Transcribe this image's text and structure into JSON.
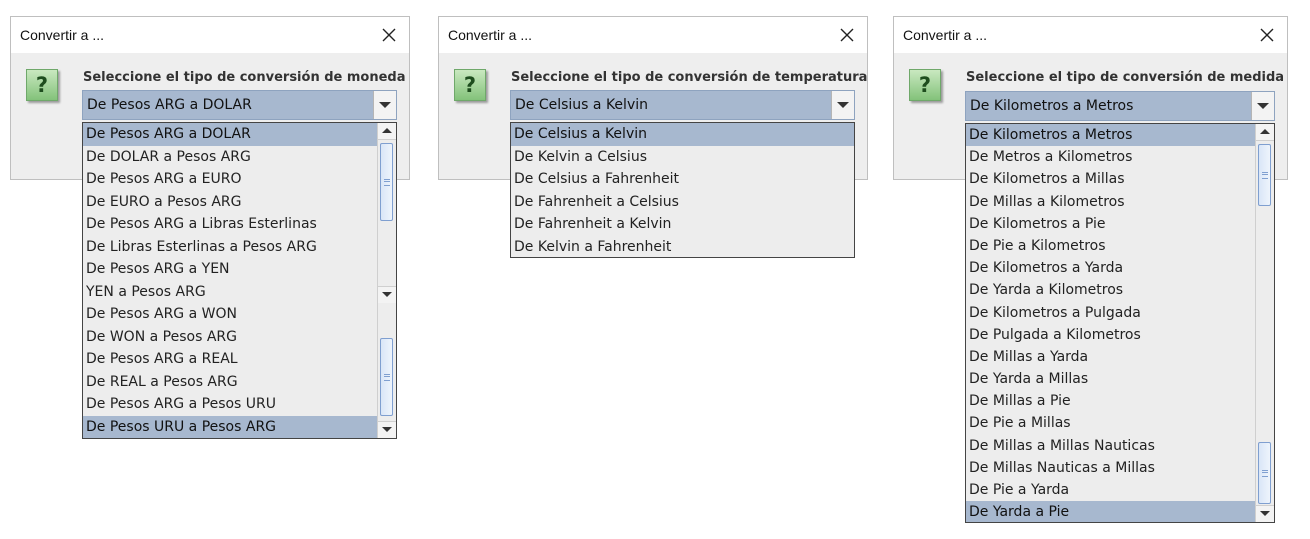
{
  "dialogs": [
    {
      "title": "Convertir a ...",
      "prompt": "Seleccione el tipo de conversión de moneda",
      "selected": "De Pesos ARG a DOLAR",
      "items": [
        "De Pesos ARG a DOLAR",
        "De DOLAR a Pesos ARG",
        "De Pesos ARG a EURO",
        "De EURO a Pesos ARG",
        "De Pesos ARG a Libras Esterlinas",
        "De Libras Esterlinas a Pesos ARG",
        "De Pesos ARG a YEN",
        "YEN a Pesos ARG",
        "De Pesos ARG a WON",
        "De WON a Pesos ARG",
        "De Pesos ARG a REAL",
        "De REAL a Pesos ARG",
        "De Pesos ARG a Pesos URU",
        "De Pesos URU a Pesos ARG"
      ],
      "highlighted_items": [
        "De Pesos ARG a DOLAR",
        "De Pesos URU a Pesos ARG"
      ]
    },
    {
      "title": "Convertir a ...",
      "prompt": "Seleccione el tipo de conversión de temperatura",
      "selected": "De Celsius a Kelvin",
      "items": [
        "De Celsius a Kelvin",
        "De Kelvin a Celsius",
        "De Celsius a Fahrenheit",
        "De Fahrenheit a Celsius",
        "De Fahrenheit a Kelvin",
        "De Kelvin a Fahrenheit"
      ],
      "highlighted_items": [
        "De Celsius a Kelvin"
      ]
    },
    {
      "title": "Convertir a ...",
      "prompt": "Seleccione el tipo de conversión de medida",
      "selected": "De Kilometros a Metros",
      "items": [
        "De Kilometros a Metros",
        "De Metros a Kilometros",
        "De Kilometros a Millas",
        "De Millas a Kilometros",
        "De Kilometros a Pie",
        "De Pie a Kilometros",
        "De Kilometros a Yarda",
        "De Yarda a Kilometros",
        "De Kilometros a Pulgada",
        "De Pulgada a Kilometros",
        "De Millas a Yarda",
        "De Yarda a Millas",
        "De Millas a Pie",
        "De Pie a Millas",
        "De Millas a Millas Nauticas",
        "De Millas Nauticas a Millas",
        "De Pie a Yarda",
        "De Yarda a Pie"
      ],
      "highlighted_items": [
        "De Kilometros a Metros",
        "De Yarda a Pie"
      ]
    }
  ],
  "icons": {
    "question": "question-icon",
    "close": "close-icon",
    "dropdown": "chevron-down-icon",
    "scroll_up": "scroll-up-icon",
    "scroll_down": "scroll-down-icon"
  },
  "colors": {
    "selection": "#a7b8cf",
    "dialog_bg": "#eeeeee",
    "icon_green": "#83c27a"
  }
}
